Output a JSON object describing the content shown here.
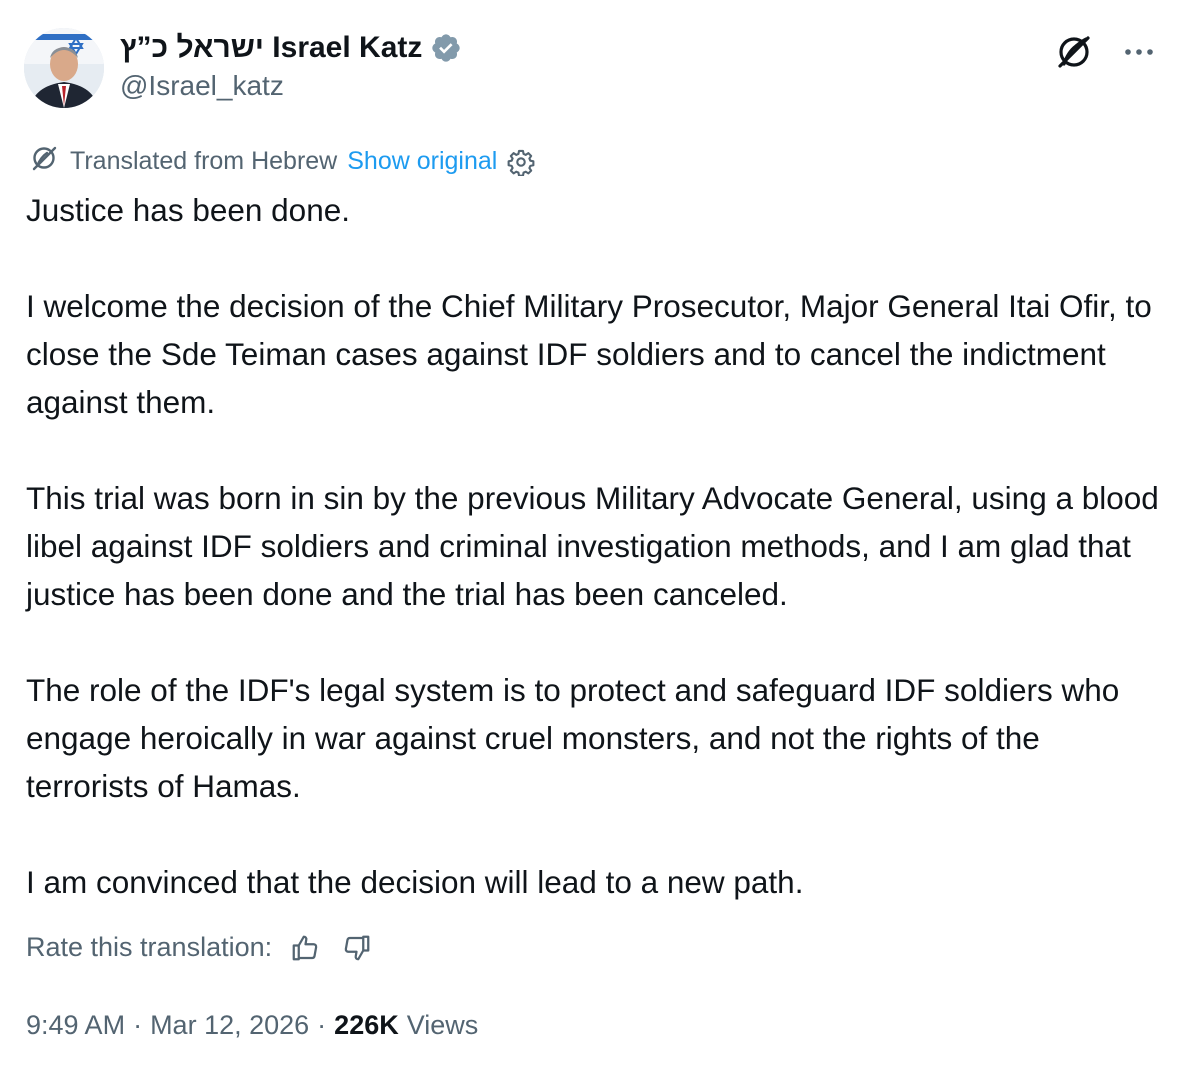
{
  "author": {
    "name": "ישראל כ”ץ Israel Katz",
    "handle": "@Israel_katz",
    "verified_color": "#829aab"
  },
  "top_actions": {
    "translate_icon": "translate-globe-icon",
    "more_icon": "more-dots-icon"
  },
  "translation": {
    "label": "Translated from Hebrew",
    "show_original": "Show original",
    "settings_icon": "gear-icon"
  },
  "body": {
    "paragraphs": [
      "Justice has been done.",
      "I welcome the decision of the Chief Military Prosecutor, Major General Itai Ofir, to close the Sde Teiman cases against IDF soldiers and to cancel the indictment against them.",
      "This trial was born in sin by the previous Military Advocate General, using a blood libel against IDF soldiers and criminal investigation methods, and I am glad that justice has been done and the trial has been canceled.",
      "The role of the IDF's legal system is to protect and safeguard IDF soldiers who engage heroically in war against cruel monsters, and not the rights of the terrorists of Hamas.",
      "I am convinced that the decision will lead to a new path."
    ]
  },
  "rate": {
    "label": "Rate this translation:",
    "up_icon": "thumbs-up-icon",
    "down_icon": "thumbs-down-icon"
  },
  "meta": {
    "time": "9:49 AM",
    "separator": "·",
    "date": "Mar 12, 2026",
    "views_count": "226K",
    "views_label": "Views"
  },
  "colors": {
    "text": "#0f1419",
    "secondary": "#536471",
    "link": "#1d9bf0"
  }
}
